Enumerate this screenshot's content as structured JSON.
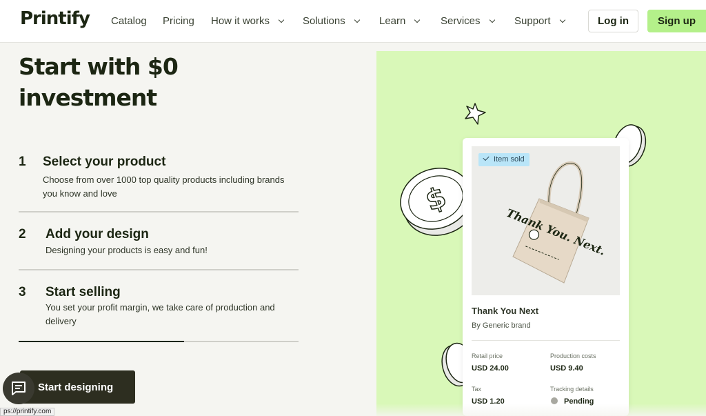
{
  "header": {
    "logo": "Printify",
    "nav": [
      {
        "label": "Catalog",
        "has_dropdown": false
      },
      {
        "label": "Pricing",
        "has_dropdown": false
      },
      {
        "label": "How it works",
        "has_dropdown": true
      },
      {
        "label": "Solutions",
        "has_dropdown": true
      },
      {
        "label": "Learn",
        "has_dropdown": true
      },
      {
        "label": "Services",
        "has_dropdown": true
      },
      {
        "label": "Support",
        "has_dropdown": true
      }
    ],
    "login_label": "Log in",
    "signup_label": "Sign up"
  },
  "main": {
    "headline": "Start with $0 investment",
    "steps": [
      {
        "number": "1",
        "title": "Select your product",
        "description": "Choose from over 1000 top quality products including brands you know and love"
      },
      {
        "number": "2",
        "title": "Add your design",
        "description": "Designing your products is easy and fun!"
      },
      {
        "number": "3",
        "title": "Start selling",
        "description": "You set your profit margin, we take care of production and delivery"
      }
    ],
    "progress_fraction": 0.59,
    "cta_label": "Start designing"
  },
  "card": {
    "badge": "Item sold",
    "bag_text": "Thank You. Next.",
    "title": "Thank You Next",
    "brand": "By Generic brand",
    "retail_label": "Retail price",
    "retail_value": "USD 24.00",
    "production_label": "Production costs",
    "production_value": "USD 9.40",
    "tax_label": "Tax",
    "tax_value": "USD 1.20",
    "tracking_label": "Tracking details",
    "tracking_value": "Pending"
  },
  "status_bar": {
    "url": "ps://printify.com"
  },
  "colors": {
    "accent": "#b4f08a",
    "hero_bg": "#d9f8b8",
    "dark": "#1c2613"
  },
  "icons": [
    "chevron-down-icon",
    "check-icon",
    "chat-icon",
    "coin-icon",
    "sparkle-icon"
  ]
}
